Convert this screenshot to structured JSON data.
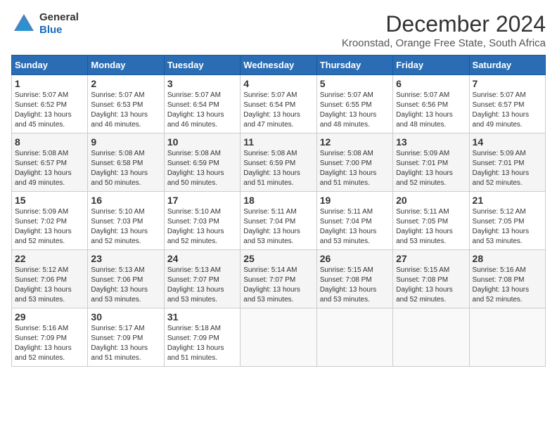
{
  "logo": {
    "general": "General",
    "blue": "Blue"
  },
  "title": "December 2024",
  "location": "Kroonstad, Orange Free State, South Africa",
  "headers": [
    "Sunday",
    "Monday",
    "Tuesday",
    "Wednesday",
    "Thursday",
    "Friday",
    "Saturday"
  ],
  "weeks": [
    [
      {
        "day": "1",
        "sunrise": "5:07 AM",
        "sunset": "6:52 PM",
        "daylight": "13 hours and 45 minutes."
      },
      {
        "day": "2",
        "sunrise": "5:07 AM",
        "sunset": "6:53 PM",
        "daylight": "13 hours and 46 minutes."
      },
      {
        "day": "3",
        "sunrise": "5:07 AM",
        "sunset": "6:54 PM",
        "daylight": "13 hours and 46 minutes."
      },
      {
        "day": "4",
        "sunrise": "5:07 AM",
        "sunset": "6:54 PM",
        "daylight": "13 hours and 47 minutes."
      },
      {
        "day": "5",
        "sunrise": "5:07 AM",
        "sunset": "6:55 PM",
        "daylight": "13 hours and 48 minutes."
      },
      {
        "day": "6",
        "sunrise": "5:07 AM",
        "sunset": "6:56 PM",
        "daylight": "13 hours and 48 minutes."
      },
      {
        "day": "7",
        "sunrise": "5:07 AM",
        "sunset": "6:57 PM",
        "daylight": "13 hours and 49 minutes."
      }
    ],
    [
      {
        "day": "8",
        "sunrise": "5:08 AM",
        "sunset": "6:57 PM",
        "daylight": "13 hours and 49 minutes."
      },
      {
        "day": "9",
        "sunrise": "5:08 AM",
        "sunset": "6:58 PM",
        "daylight": "13 hours and 50 minutes."
      },
      {
        "day": "10",
        "sunrise": "5:08 AM",
        "sunset": "6:59 PM",
        "daylight": "13 hours and 50 minutes."
      },
      {
        "day": "11",
        "sunrise": "5:08 AM",
        "sunset": "6:59 PM",
        "daylight": "13 hours and 51 minutes."
      },
      {
        "day": "12",
        "sunrise": "5:08 AM",
        "sunset": "7:00 PM",
        "daylight": "13 hours and 51 minutes."
      },
      {
        "day": "13",
        "sunrise": "5:09 AM",
        "sunset": "7:01 PM",
        "daylight": "13 hours and 52 minutes."
      },
      {
        "day": "14",
        "sunrise": "5:09 AM",
        "sunset": "7:01 PM",
        "daylight": "13 hours and 52 minutes."
      }
    ],
    [
      {
        "day": "15",
        "sunrise": "5:09 AM",
        "sunset": "7:02 PM",
        "daylight": "13 hours and 52 minutes."
      },
      {
        "day": "16",
        "sunrise": "5:10 AM",
        "sunset": "7:03 PM",
        "daylight": "13 hours and 52 minutes."
      },
      {
        "day": "17",
        "sunrise": "5:10 AM",
        "sunset": "7:03 PM",
        "daylight": "13 hours and 52 minutes."
      },
      {
        "day": "18",
        "sunrise": "5:11 AM",
        "sunset": "7:04 PM",
        "daylight": "13 hours and 53 minutes."
      },
      {
        "day": "19",
        "sunrise": "5:11 AM",
        "sunset": "7:04 PM",
        "daylight": "13 hours and 53 minutes."
      },
      {
        "day": "20",
        "sunrise": "5:11 AM",
        "sunset": "7:05 PM",
        "daylight": "13 hours and 53 minutes."
      },
      {
        "day": "21",
        "sunrise": "5:12 AM",
        "sunset": "7:05 PM",
        "daylight": "13 hours and 53 minutes."
      }
    ],
    [
      {
        "day": "22",
        "sunrise": "5:12 AM",
        "sunset": "7:06 PM",
        "daylight": "13 hours and 53 minutes."
      },
      {
        "day": "23",
        "sunrise": "5:13 AM",
        "sunset": "7:06 PM",
        "daylight": "13 hours and 53 minutes."
      },
      {
        "day": "24",
        "sunrise": "5:13 AM",
        "sunset": "7:07 PM",
        "daylight": "13 hours and 53 minutes."
      },
      {
        "day": "25",
        "sunrise": "5:14 AM",
        "sunset": "7:07 PM",
        "daylight": "13 hours and 53 minutes."
      },
      {
        "day": "26",
        "sunrise": "5:15 AM",
        "sunset": "7:08 PM",
        "daylight": "13 hours and 53 minutes."
      },
      {
        "day": "27",
        "sunrise": "5:15 AM",
        "sunset": "7:08 PM",
        "daylight": "13 hours and 52 minutes."
      },
      {
        "day": "28",
        "sunrise": "5:16 AM",
        "sunset": "7:08 PM",
        "daylight": "13 hours and 52 minutes."
      }
    ],
    [
      {
        "day": "29",
        "sunrise": "5:16 AM",
        "sunset": "7:09 PM",
        "daylight": "13 hours and 52 minutes."
      },
      {
        "day": "30",
        "sunrise": "5:17 AM",
        "sunset": "7:09 PM",
        "daylight": "13 hours and 51 minutes."
      },
      {
        "day": "31",
        "sunrise": "5:18 AM",
        "sunset": "7:09 PM",
        "daylight": "13 hours and 51 minutes."
      },
      null,
      null,
      null,
      null
    ]
  ]
}
